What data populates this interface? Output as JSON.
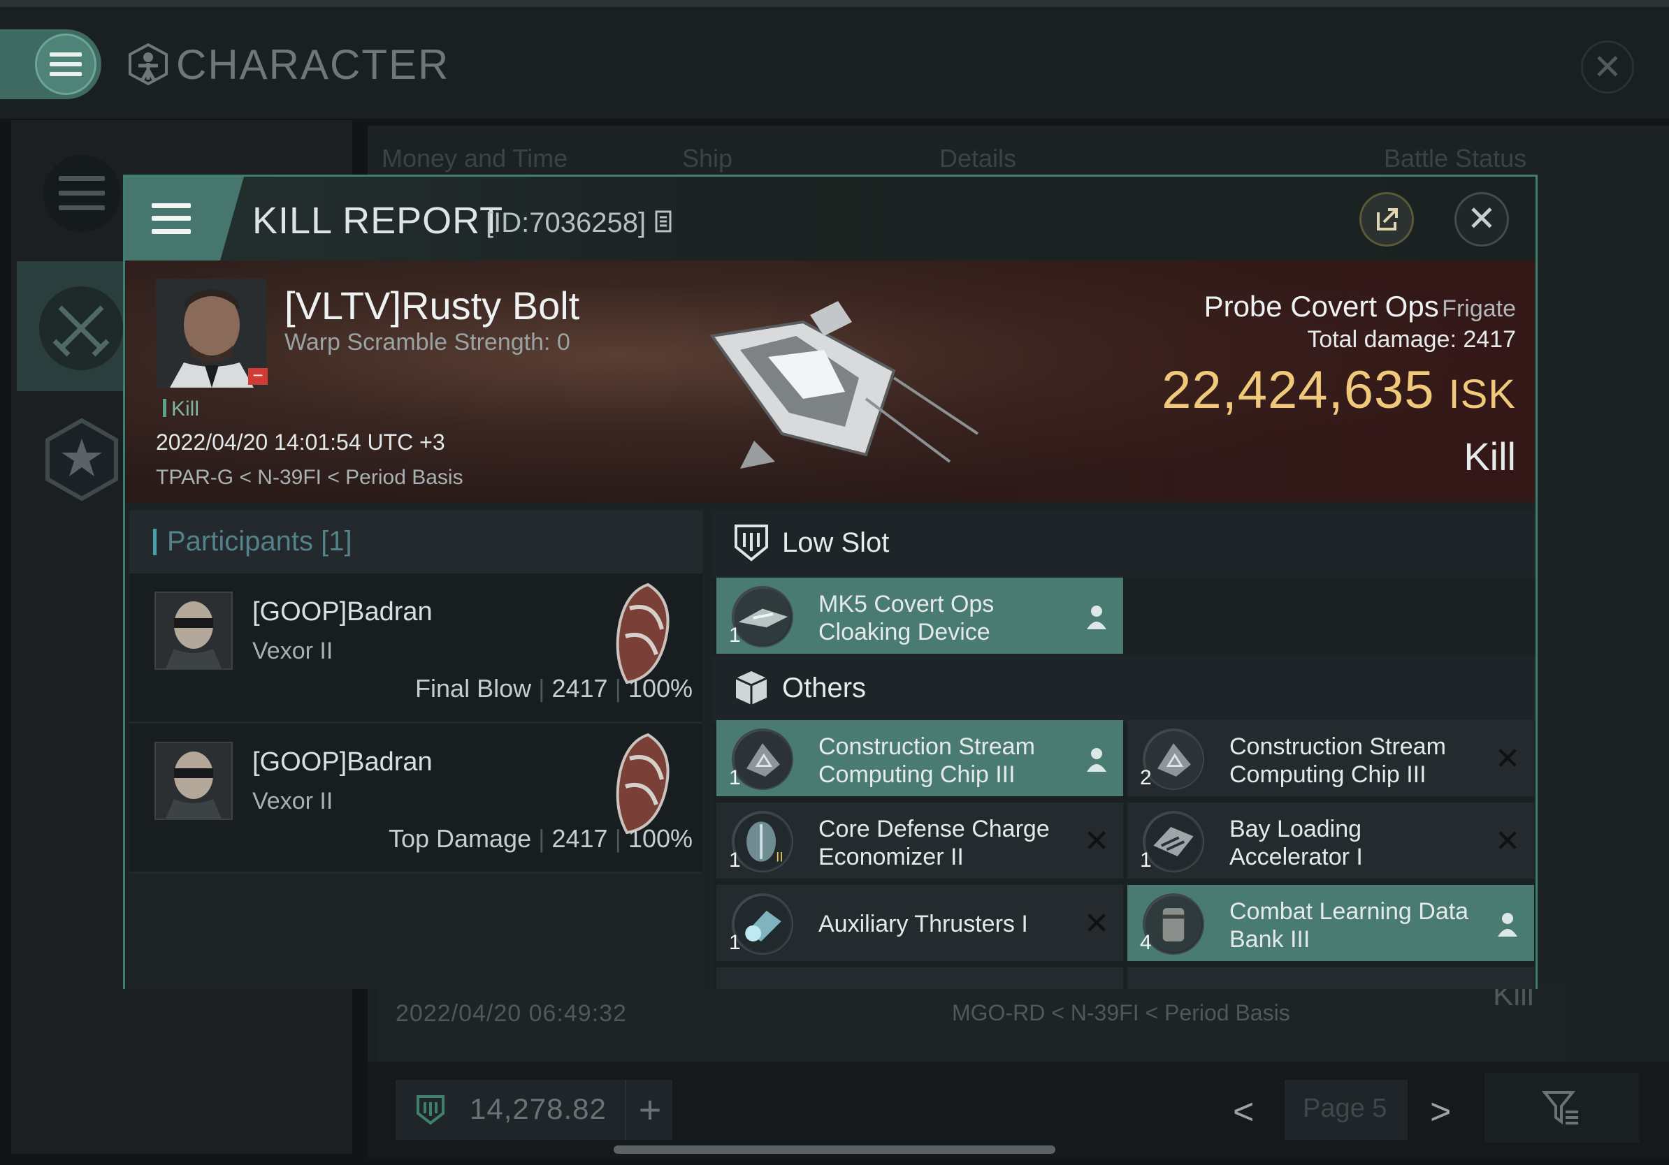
{
  "window": {
    "title": "CHARACTER"
  },
  "background": {
    "tabs": [
      "Money and Time",
      "Ship",
      "Details",
      "Battle Status"
    ],
    "row_date": "2022/04/20  06:49:32",
    "row_location": "MGO-RD < N-39FI < Period Basis",
    "row_result": "Kill",
    "wallet_amount": "14,278.82",
    "wallet_plus": "+",
    "page_label": "Page 5",
    "prev": "<",
    "next": ">"
  },
  "kill_report": {
    "title": "KILL REPORT",
    "id": "[ID:7036258]",
    "victim": {
      "name": "[VLTV]Rusty Bolt",
      "warp_scramble": "Warp Scramble Strength: 0",
      "tag": "Kill",
      "datetime": "2022/04/20 14:01:54 UTC +3",
      "location": "TPAR-G < N-39FI < Period Basis"
    },
    "ship": {
      "name": "Probe Covert Ops",
      "class": "Frigate",
      "total_damage_label": "Total damage:",
      "total_damage": "2417",
      "isk_value": "22,424,635",
      "isk_unit": "ISK",
      "result": "Kill"
    },
    "participants": {
      "title": "Participants",
      "count": "[1]",
      "rows": [
        {
          "name": "[GOOP]Badran",
          "ship": "Vexor II",
          "role": "Final Blow",
          "damage": "2417",
          "percent": "100%"
        },
        {
          "name": "[GOOP]Badran",
          "ship": "Vexor II",
          "role": "Top Damage",
          "damage": "2417",
          "percent": "100%"
        }
      ]
    },
    "sections": {
      "low_slot": "Low Slot",
      "others": "Others"
    },
    "low_slot_items": [
      {
        "name": "MK5 Covert Ops Cloaking Device",
        "qty": "1",
        "status": "dropped"
      }
    ],
    "other_items": [
      {
        "name": "Construction Stream Computing Chip III",
        "qty": "1",
        "status": "dropped"
      },
      {
        "name": "Construction Stream Computing Chip III",
        "qty": "2",
        "status": "destroyed"
      },
      {
        "name": "Core Defense Charge Economizer II",
        "qty": "1",
        "status": "destroyed"
      },
      {
        "name": "Bay Loading Accelerator I",
        "qty": "1",
        "status": "destroyed"
      },
      {
        "name": "Auxiliary Thrusters I",
        "qty": "1",
        "status": "destroyed"
      },
      {
        "name": "Combat Learning Data Bank III",
        "qty": "4",
        "status": "dropped"
      }
    ]
  },
  "colors": {
    "accent": "#4a7b73",
    "isk": "#f0ca7a",
    "victim_badge": "#d23a35"
  }
}
